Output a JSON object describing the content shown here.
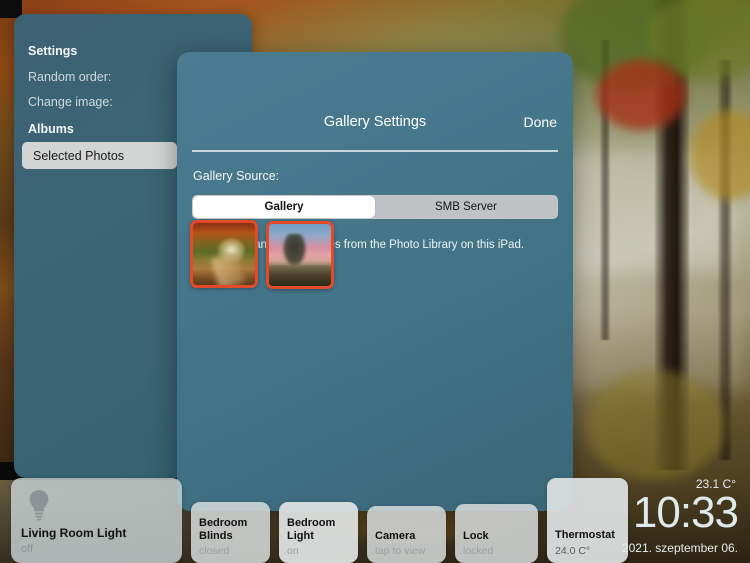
{
  "settings_panel": {
    "title": "Settings",
    "rows": [
      {
        "label": "Random order:"
      },
      {
        "label": "Change image:"
      }
    ],
    "albums_header": "Albums",
    "selected_album": "Selected Photos"
  },
  "modal": {
    "title": "Gallery Settings",
    "done_label": "Done",
    "source_label": "Gallery Source:",
    "segments": [
      {
        "label": "Gallery",
        "selected": true
      },
      {
        "label": "SMB Server",
        "selected": false
      }
    ],
    "hint": "You can select images from the Photo Library on this iPad.",
    "thumbnails": [
      {
        "name": "autumn-forest-path",
        "selected": true
      },
      {
        "name": "lone-tree-sunset",
        "selected": true
      }
    ],
    "selection_color": "#e24a2a"
  },
  "dock": {
    "tiles": [
      {
        "name": "Living Room Light",
        "state": "off",
        "icon": "lightbulb-icon"
      },
      {
        "name": "Bedroom\nBlinds",
        "state": "closed"
      },
      {
        "name": "Bedroom\nLight",
        "state": "on"
      },
      {
        "name": "Camera",
        "state": "tap to view"
      },
      {
        "name": "Lock",
        "state": "locked"
      },
      {
        "name": "Thermostat",
        "state": "24.0 C°"
      }
    ]
  },
  "status": {
    "outside_temperature": "23.1 C°",
    "time": "10:33",
    "date": "2021. szeptember 06."
  }
}
